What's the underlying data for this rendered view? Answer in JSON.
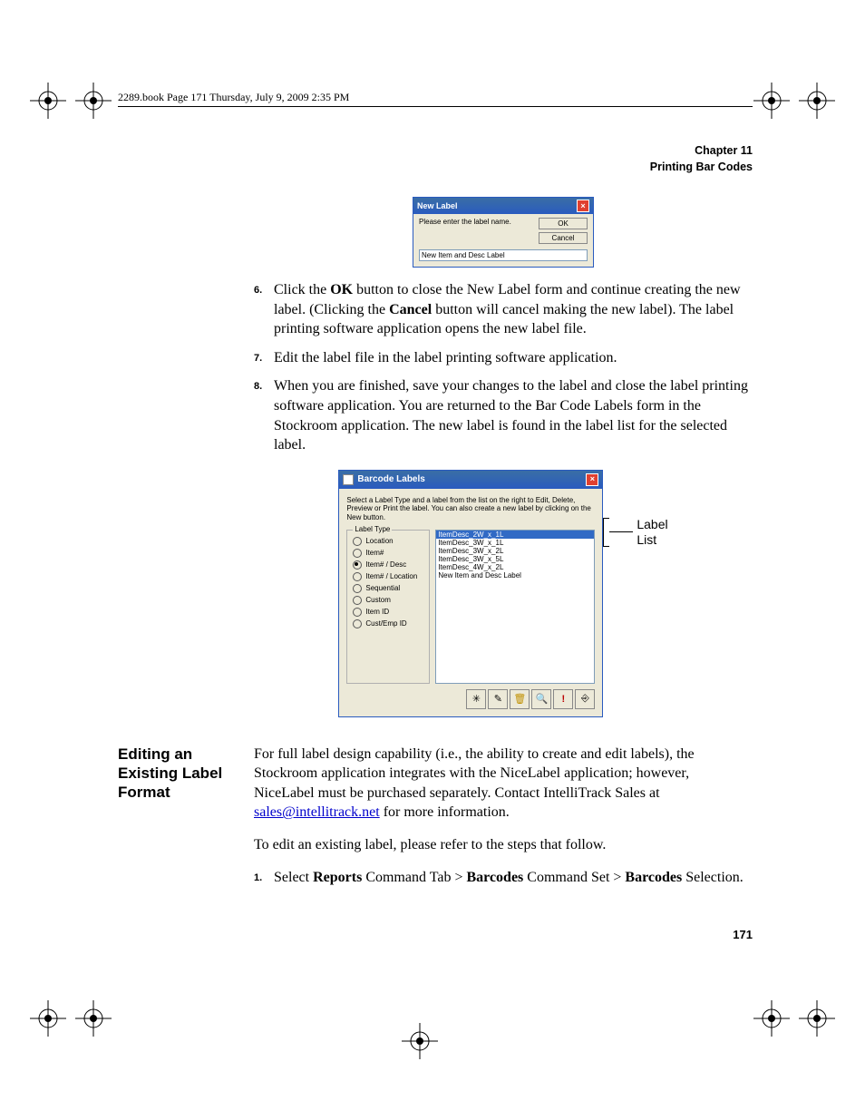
{
  "book_header": "2289.book  Page 171  Thursday, July 9, 2009  2:35 PM",
  "chapter": {
    "line1": "Chapter 11",
    "line2": "Printing Bar Codes"
  },
  "new_label_dialog": {
    "title": "New Label",
    "prompt": "Please enter the label name.",
    "ok": "OK",
    "cancel": "Cancel",
    "value": "New Item and Desc Label"
  },
  "steps": {
    "s6a": "Click the ",
    "s6_ok": "OK",
    "s6b": " button to close the New Label form and continue creating the new label. (Clicking the ",
    "s6_cancel": "Cancel",
    "s6c": " button will cancel making the new label). The label printing software application opens the new label file.",
    "s7": "Edit the label file in the label printing software application.",
    "s8": "When you are finished, save your changes to the label and close the label printing software application. You are returned to the Bar Code Labels form in the Stockroom application. The new label is found in the label list for the selected label."
  },
  "barcode_dialog": {
    "title": "Barcode Labels",
    "instr": "Select a Label Type and a label from the list on the right to Edit, Delete, Preview or Print the label. You can also create a new label by clicking on the New button.",
    "group_title": "Label Type",
    "radios": [
      "Location",
      "Item#",
      "Item# / Desc",
      "Item# / Location",
      "Sequential",
      "Custom",
      "Item ID",
      "Cust/Emp ID"
    ],
    "selected_radio": 2,
    "list_items": [
      "ItemDesc_2W_x_1L",
      "ItemDesc_3W_x_1L",
      "ItemDesc_3W_x_2L",
      "ItemDesc_3W_x_5L",
      "ItemDesc_4W_x_2L",
      "New Item and Desc Label"
    ],
    "selected_item": 0,
    "toolbar_icons": [
      "new-icon",
      "edit-icon",
      "delete-icon",
      "preview-icon",
      "print-icon",
      "close-icon"
    ]
  },
  "callout": {
    "l1": "Label",
    "l2": "List"
  },
  "section": {
    "title": "Editing an Existing Label Format",
    "p1a": "For full label design capability (i.e., the ability to create and edit labels), the Stockroom application integrates with the NiceLabel application; however, NiceLabel must be purchased separately. Contact IntelliTrack Sales at ",
    "email": "sales@intellitrack.net",
    "p1b": " for more information.",
    "p2": "To edit an existing label, please refer to the steps that follow.",
    "step1a": "Select ",
    "step1_b1": "Reports",
    "step1b": " Command Tab > ",
    "step1_b2": "Barcodes",
    "step1c": " Command Set > ",
    "step1_b3": "Barcodes",
    "step1d": " Selection."
  },
  "page_number": "171"
}
